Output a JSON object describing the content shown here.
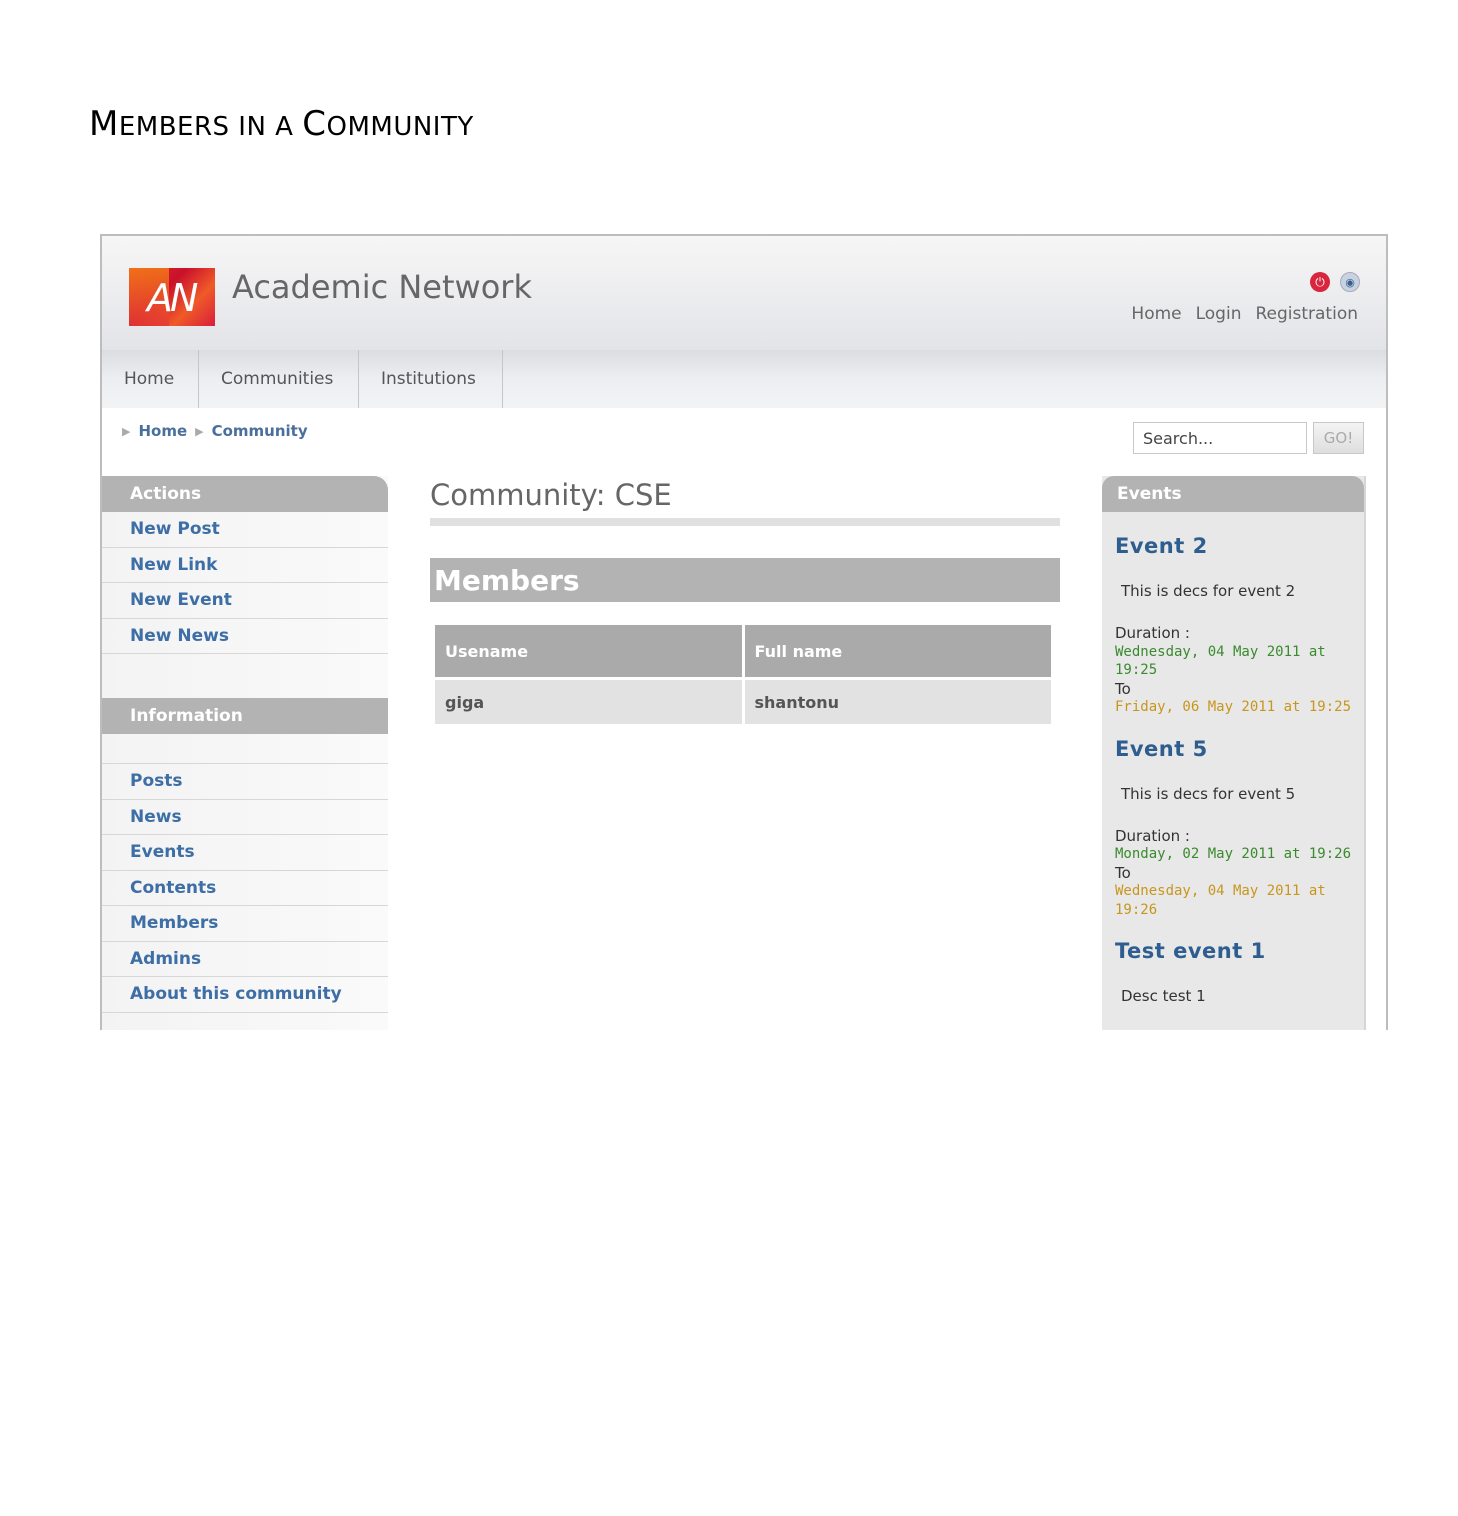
{
  "document": {
    "title_first": "M",
    "title_rest_1": "EMBERS IN A ",
    "title_c": "C",
    "title_rest_2": "OMMUNITY"
  },
  "site": {
    "logo_text": "AN",
    "name": "Academic Network",
    "top_links": [
      "Home",
      "Login",
      "Registration"
    ]
  },
  "nav": {
    "tabs": [
      "Home",
      "Communities",
      "Institutions"
    ]
  },
  "breadcrumb": [
    "Home",
    "Community"
  ],
  "search": {
    "placeholder": "Search...",
    "button": "GO!"
  },
  "sidebar": {
    "actions_title": "Actions",
    "actions": [
      "New Post",
      "New Link",
      "New Event",
      "New News"
    ],
    "info_title": "Information",
    "info": [
      "Posts",
      "News",
      "Events",
      "Contents",
      "Members",
      "Admins",
      "About this community"
    ]
  },
  "main": {
    "title": "Community: CSE",
    "section": "Members",
    "columns": [
      "Usename",
      "Full name"
    ],
    "rows": [
      [
        "giga",
        "shantonu"
      ]
    ]
  },
  "events": {
    "title": "Events",
    "items": [
      {
        "name": "Event 2",
        "desc": "This is decs for event 2",
        "duration_label": "Duration :",
        "start_1": "Wednesday, 04 May 2011 at",
        "start_2": "19:25",
        "to": "To",
        "end_1": "Friday, 06 May 2011 at 19:25",
        "end_2": ""
      },
      {
        "name": "Event 5",
        "desc": "This is decs for event 5",
        "duration_label": "Duration :",
        "start_1": "Monday, 02 May 2011 at 19:26",
        "start_2": "",
        "to": "To",
        "end_1": "Wednesday, 04 May 2011 at",
        "end_2": "19:26"
      },
      {
        "name": "Test event 1",
        "desc": "Desc test 1"
      }
    ]
  },
  "colors": {
    "link_blue": "#3d6ea5",
    "box_gray": "#b3b3b3",
    "start_green": "#3a8a2e",
    "end_gold": "#c8961e"
  }
}
